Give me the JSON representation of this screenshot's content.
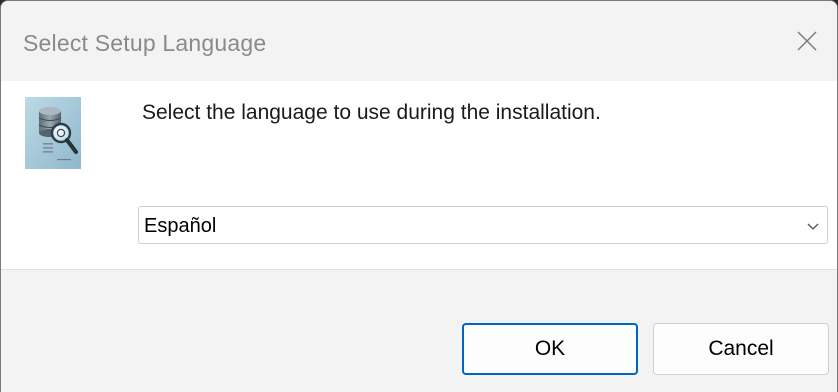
{
  "window": {
    "title": "Select Setup Language",
    "close_icon": "close-icon"
  },
  "icon": "setup-database-search-icon",
  "prompt": "Select the language to use during the installation.",
  "language_select": {
    "selected": "Español",
    "chevron_icon": "chevron-down-icon"
  },
  "buttons": {
    "ok_label": "OK",
    "cancel_label": "Cancel"
  },
  "colors": {
    "accent": "#0067c0",
    "titlebar_bg": "#f3f3f3",
    "footer_bg": "#f3f3f3"
  }
}
